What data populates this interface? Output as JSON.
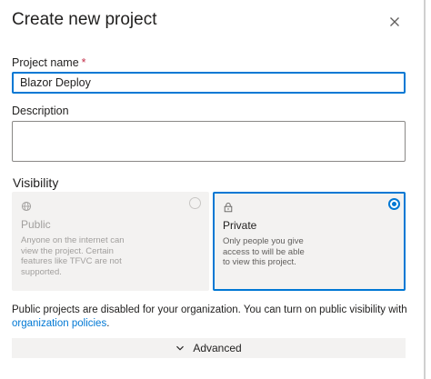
{
  "dialog": {
    "title": "Create new project",
    "close_icon": "close-icon"
  },
  "project_name": {
    "label": "Project name",
    "required_mark": "*",
    "value": "Blazor Deploy"
  },
  "description": {
    "label": "Description",
    "value": ""
  },
  "visibility": {
    "label": "Visibility",
    "options": [
      {
        "icon": "globe-icon",
        "title": "Public",
        "description": "Anyone on the internet can view the project. Certain features like TFVC are not supported.",
        "selected": false,
        "disabled": true
      },
      {
        "icon": "lock-icon",
        "title": "Private",
        "description": "Only people you give access to will be able to view this project.",
        "selected": true,
        "disabled": false
      }
    ]
  },
  "notice": {
    "text": "Public projects are disabled for your organization. You can turn on public visibility with ",
    "link": "organization policies",
    "suffix": "."
  },
  "advanced": {
    "label": "Advanced",
    "icon": "chevron-down-icon"
  },
  "colors": {
    "accent": "#0078d4",
    "required": "#c4314b",
    "card_bg": "#f3f2f1",
    "disabled_text": "#a19f9d"
  }
}
